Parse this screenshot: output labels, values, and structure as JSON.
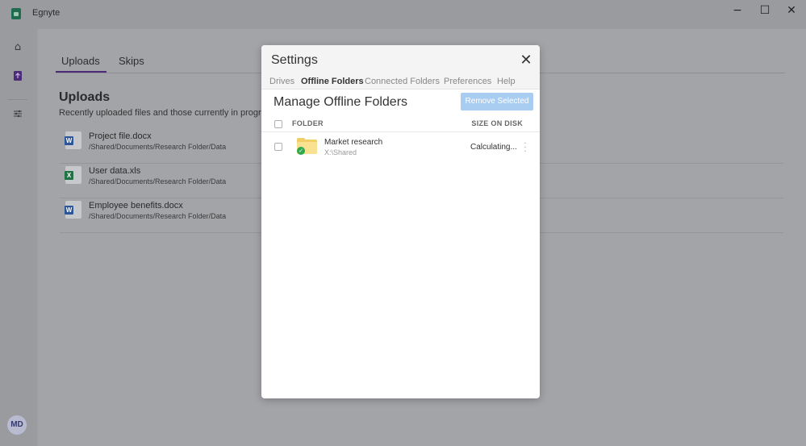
{
  "app": {
    "title": "Egnyte",
    "minimize": "−",
    "maximize": "☐",
    "close": "✕"
  },
  "sidebar": {
    "avatar_initials": "MD",
    "icons": [
      "home-icon",
      "uploads-icon",
      "settings-sliders-icon"
    ]
  },
  "main": {
    "tabs": [
      {
        "label": "Uploads",
        "active": true
      },
      {
        "label": "Skips",
        "active": false
      }
    ],
    "title": "Uploads",
    "subtitle": "Recently uploaded files and those currently in progress",
    "files": [
      {
        "name": "Project file.docx",
        "path": "/Shared/Documents/Research Folder/Data",
        "type": "W"
      },
      {
        "name": "User data.xls",
        "path": "/Shared/Documents/Research Folder/Data",
        "type": "X"
      },
      {
        "name": "Employee benefits.docx",
        "path": "/Shared/Documents/Research Folder/Data",
        "type": "W"
      }
    ]
  },
  "settings": {
    "title": "Settings",
    "close_glyph": "✕",
    "tabs": [
      {
        "label": "Drives",
        "active": false
      },
      {
        "label": "Offline Folders",
        "active": true
      },
      {
        "label": "Connected Folders",
        "active": false
      },
      {
        "label": "Preferences",
        "active": false
      },
      {
        "label": "Help",
        "active": false
      }
    ],
    "section_title": "Manage Offline Folders",
    "remove_button": "Remove Selected",
    "columns": {
      "folder": "FOLDER",
      "size": "SIZE ON DISK"
    },
    "folders": [
      {
        "name": "Market research",
        "path": "X:\\Shared",
        "size": "Calculating..."
      }
    ]
  },
  "colors": {
    "accent_tab": "#4b2a7a",
    "button_disabled": "#a9cdf0",
    "folder": "#f0cf66",
    "sync_ok": "#2fa84f"
  }
}
